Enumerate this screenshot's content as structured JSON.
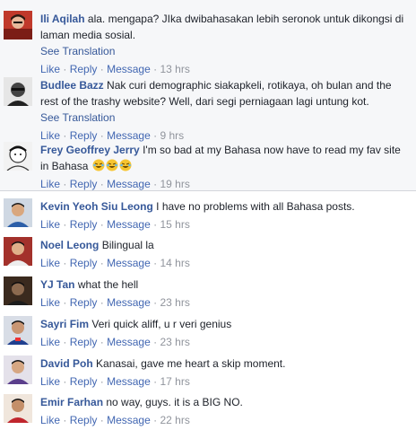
{
  "actions": {
    "like": "Like",
    "reply": "Reply",
    "message": "Message",
    "separator": "·"
  },
  "comments": [
    {
      "name": "Ili Aqilah",
      "text": "ala. mengapa? JIka dwibahasakan lebih seronok untuk dikongsi di laman media sosial.",
      "see_translation": "See Translation",
      "time": "13 hrs",
      "avatar": "user-avatar-red-photo"
    },
    {
      "name": "Budlee Bazz",
      "text": "Nak curi demographic siakapkeli, rotikaya, oh bulan and the rest of the trashy website? Well, dari segi perniagaan lagi untung kot.",
      "see_translation": "See Translation",
      "time": "9 hrs",
      "avatar": "user-avatar-bw-photo"
    },
    {
      "name": "Frey Geoffrey Jerry",
      "text": "I'm so bad at my Bahasa now have to read my fav site in Bahasa",
      "emoji": "crying-laughing-emoji x3",
      "time": "19 hrs",
      "avatar": "user-avatar-sketch"
    },
    {
      "name": "Kevin Yeoh Siu Leong",
      "text": "I have no problems with all Bahasa posts.",
      "time": "15 hrs",
      "avatar": "user-avatar-blue-shirt"
    },
    {
      "name": "Noel Leong",
      "text": "Bilingual la",
      "time": "14 hrs",
      "avatar": "user-avatar-red-bg"
    },
    {
      "name": "YJ Tan",
      "text": "what the hell",
      "time": "23 hrs",
      "avatar": "user-avatar-dark"
    },
    {
      "name": "Sayri Fim",
      "text": "Veri quick aliff, u r veri genius",
      "time": "23 hrs",
      "avatar": "user-avatar-blue-jersey"
    },
    {
      "name": "David Poh",
      "text": "Kanasai, gave me heart a skip moment.",
      "time": "17 hrs",
      "avatar": "user-avatar-purple"
    },
    {
      "name": "Emir Farhan",
      "text": "no way, guys. it is a BIG NO.",
      "time": "22 hrs",
      "avatar": "user-avatar-red-shirt"
    }
  ],
  "colors": {
    "name": "#365899",
    "link": "#4267b2",
    "meta": "#90949c",
    "reply_bg": "#f6f7f9",
    "divider": "#d3d6db"
  }
}
